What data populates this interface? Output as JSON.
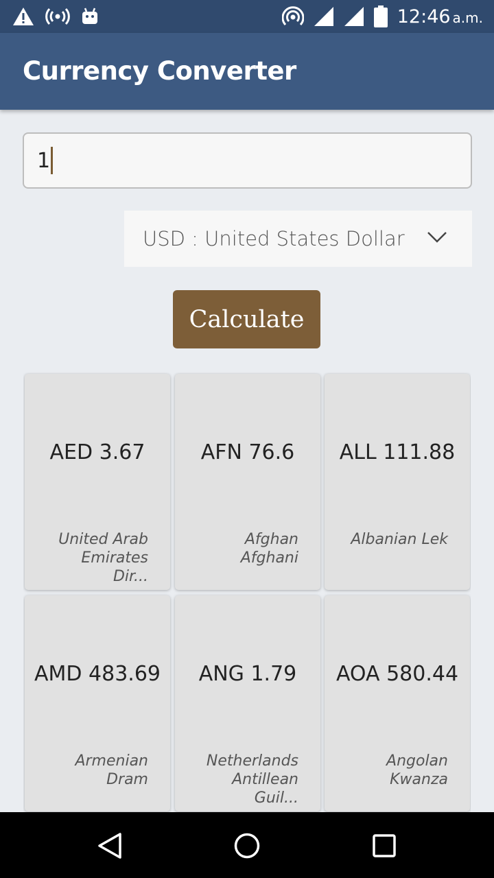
{
  "status_bar": {
    "time": "12:46",
    "ampm": "a.m.",
    "icons": [
      "warning-icon",
      "broadcast-icon",
      "android-icon",
      "hotspot-icon",
      "signal-icon",
      "signal-icon",
      "battery-icon"
    ]
  },
  "app_bar": {
    "title": "Currency Converter"
  },
  "amount_input": {
    "value": "1"
  },
  "currency_select": {
    "selected": "USD : United States Dollar",
    "icon": "chevron-down-icon"
  },
  "calculate_button": {
    "label": "Calculate",
    "color": "#7d5e38"
  },
  "results": [
    {
      "value": "AED 3.67",
      "name": "United Arab Emirates Dir..."
    },
    {
      "value": "AFN 76.6",
      "name": "Afghan Afghani"
    },
    {
      "value": "ALL 111.88",
      "name": "Albanian Lek"
    },
    {
      "value": "AMD 483.69",
      "name": "Armenian Dram"
    },
    {
      "value": "ANG 1.79",
      "name": "Netherlands Antillean Guil..."
    },
    {
      "value": "AOA 580.44",
      "name": "Angolan Kwanza"
    }
  ],
  "nav_bar": {
    "icons": [
      "back-icon",
      "home-icon",
      "recents-icon"
    ]
  },
  "colors": {
    "status_bar": "#304a6e",
    "app_bar": "#3d5a82",
    "background": "#eaedf1",
    "card": "#e1e1e1"
  }
}
